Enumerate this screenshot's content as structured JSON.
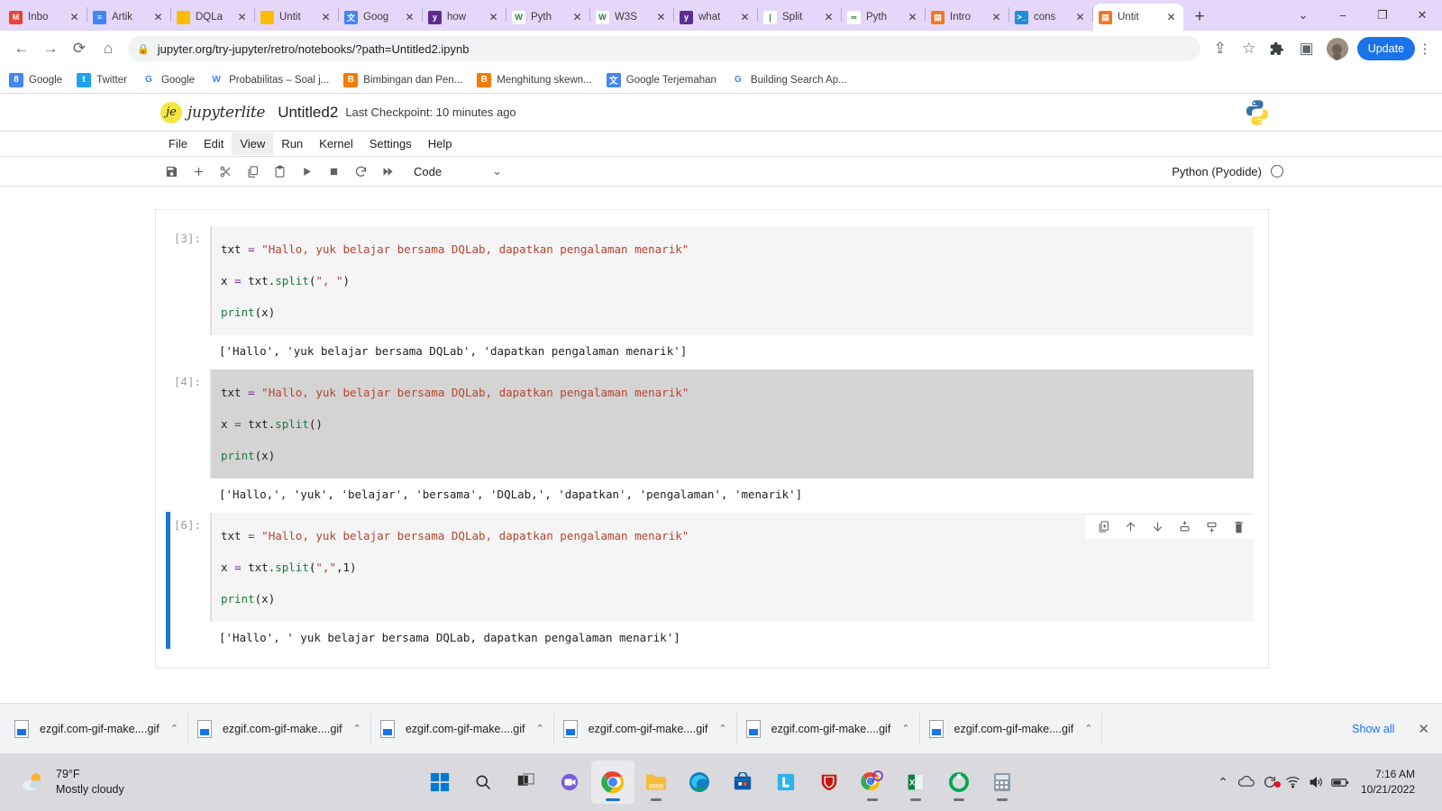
{
  "browser": {
    "tabs": [
      {
        "title": "Inbo",
        "icon": "gmail-icon",
        "color": "#ea4335",
        "glyph": "M",
        "active": false
      },
      {
        "title": "Artik",
        "icon": "docs-icon",
        "color": "#4285f4",
        "glyph": "≡",
        "active": false
      },
      {
        "title": "DQLa",
        "icon": "folder-icon",
        "color": "#fbbc04",
        "glyph": "",
        "active": false
      },
      {
        "title": "Untit",
        "icon": "folder-icon",
        "color": "#fbbc04",
        "glyph": "",
        "active": false
      },
      {
        "title": "Goog",
        "icon": "translate-icon",
        "color": "#4285f4",
        "glyph": "文",
        "active": false
      },
      {
        "title": "how",
        "icon": "w3schools-icon",
        "color": "#5c2d91",
        "glyph": "y",
        "active": false
      },
      {
        "title": "Pyth",
        "icon": "w3schools-green-icon",
        "color": "#ffffff",
        "glyph": "W",
        "active": false
      },
      {
        "title": "W3S",
        "icon": "w3schools-green-icon",
        "color": "#ffffff",
        "glyph": "W",
        "active": false
      },
      {
        "title": "what",
        "icon": "w3schools-icon",
        "color": "#5c2d91",
        "glyph": "y",
        "active": false
      },
      {
        "title": "Split",
        "icon": "split-icon",
        "color": "#ffffff",
        "glyph": "|",
        "active": false
      },
      {
        "title": "Pyth",
        "icon": "python-docs-icon",
        "color": "#ffffff",
        "glyph": "∞",
        "active": false
      },
      {
        "title": "Intro",
        "icon": "jupyter-icon",
        "color": "#f37726",
        "glyph": "▤",
        "active": false
      },
      {
        "title": "cons",
        "icon": "terminal-icon",
        "color": "#1e8fd5",
        "glyph": ">_",
        "active": false
      },
      {
        "title": "Untit",
        "icon": "jupyter-icon",
        "color": "#f37726",
        "glyph": "▤",
        "active": true
      }
    ],
    "new_tab_label": "+",
    "window_controls": {
      "list": "⌄",
      "minimize": "−",
      "maximize": "❐",
      "close": "✕"
    },
    "nav": {
      "back": "←",
      "forward": "→",
      "reload": "⟳",
      "home": "⌂"
    },
    "address": {
      "url": "jupyter.org/try-jupyter/retro/notebooks/?path=Untitled2.ipynb",
      "lock_icon": "lock-icon",
      "placeholder": "Search Google or type a URL"
    },
    "omnibox_actions": {
      "share": "⇪",
      "bookmark": "☆",
      "extensions": "🧩",
      "sidepanel": "▣"
    },
    "update_label": "Update",
    "menu_label": "⋮",
    "bookmarks": [
      {
        "label": "Google",
        "icon": "google-blue-icon",
        "color": "#4285f4",
        "glyph": "8"
      },
      {
        "label": "Twitter",
        "icon": "twitter-icon",
        "color": "#1da1f2",
        "glyph": "t"
      },
      {
        "label": "Google",
        "icon": "google-icon",
        "color": "#ffffff",
        "glyph": "G"
      },
      {
        "label": "Probabilitas – Soal j...",
        "icon": "wordpress-icon",
        "color": "#ffffff",
        "glyph": "W"
      },
      {
        "label": "Bimbingan dan Pen...",
        "icon": "blogger-icon",
        "color": "#f57c00",
        "glyph": "B"
      },
      {
        "label": "Menghitung skewn...",
        "icon": "blogger-icon",
        "color": "#f57c00",
        "glyph": "B"
      },
      {
        "label": "Google Terjemahan",
        "icon": "translate-icon",
        "color": "#4285f4",
        "glyph": "文"
      },
      {
        "label": "Building Search Ap...",
        "icon": "google-icon",
        "color": "#ffffff",
        "glyph": "G"
      }
    ]
  },
  "jupyter": {
    "brand": "jupyterlite",
    "brand_glyph": "je",
    "notebook_title": "Untitled2",
    "checkpoint": "Last Checkpoint: 10 minutes ago",
    "python_logo_icon": "python-logo-icon",
    "menus": [
      {
        "label": "File",
        "active": false
      },
      {
        "label": "Edit",
        "active": false
      },
      {
        "label": "View",
        "active": true
      },
      {
        "label": "Run",
        "active": false
      },
      {
        "label": "Kernel",
        "active": false
      },
      {
        "label": "Settings",
        "active": false
      },
      {
        "label": "Help",
        "active": false
      }
    ],
    "toolbar": [
      {
        "name": "save-icon",
        "glyph": "save"
      },
      {
        "name": "add-cell-icon",
        "glyph": "+"
      },
      {
        "name": "cut-icon",
        "glyph": "cut"
      },
      {
        "name": "copy-icon",
        "glyph": "copy"
      },
      {
        "name": "paste-icon",
        "glyph": "paste"
      },
      {
        "name": "run-icon",
        "glyph": "▶"
      },
      {
        "name": "stop-icon",
        "glyph": "■"
      },
      {
        "name": "restart-icon",
        "glyph": "⟳"
      },
      {
        "name": "restart-run-all-icon",
        "glyph": "▶▶"
      }
    ],
    "cell_type": {
      "value": "Code",
      "caret": "⌄"
    },
    "kernel": {
      "name": "Python (Pyodide)",
      "status_icon": "kernel-idle-circle"
    },
    "cell_tools": [
      {
        "name": "duplicate-cell-icon"
      },
      {
        "name": "move-cell-up-icon"
      },
      {
        "name": "move-cell-down-icon"
      },
      {
        "name": "insert-cell-above-icon"
      },
      {
        "name": "insert-cell-below-icon"
      },
      {
        "name": "delete-cell-icon"
      }
    ],
    "cells": [
      {
        "prompt": "[3]:",
        "active": false,
        "selected_code": false,
        "lines": [
          [
            {
              "t": "txt ",
              "c": "plain"
            },
            {
              "t": "=",
              "c": "op"
            },
            {
              "t": " ",
              "c": "plain"
            },
            {
              "t": "\"Hallo, yuk belajar bersama DQLab, dapatkan pengalaman menarik\"",
              "c": "str"
            }
          ],
          [
            {
              "t": "x ",
              "c": "plain"
            },
            {
              "t": "=",
              "c": "op"
            },
            {
              "t": " txt.",
              "c": "plain"
            },
            {
              "t": "split",
              "c": "fn"
            },
            {
              "t": "(",
              "c": "plain"
            },
            {
              "t": "\", \"",
              "c": "str"
            },
            {
              "t": ")",
              "c": "plain"
            }
          ],
          [
            {
              "t": "print",
              "c": "fn"
            },
            {
              "t": "(x)",
              "c": "plain"
            }
          ]
        ],
        "output": "['Hallo', 'yuk belajar bersama DQLab', 'dapatkan pengalaman menarik']"
      },
      {
        "prompt": "[4]:",
        "active": false,
        "selected_code": true,
        "lines": [
          [
            {
              "t": "txt ",
              "c": "plain"
            },
            {
              "t": "=",
              "c": "op"
            },
            {
              "t": " ",
              "c": "plain"
            },
            {
              "t": "\"Hallo, yuk belajar bersama DQLab, dapatkan pengalaman menarik\"",
              "c": "str"
            }
          ],
          [
            {
              "t": "x ",
              "c": "plain"
            },
            {
              "t": "=",
              "c": "op"
            },
            {
              "t": " txt.",
              "c": "plain"
            },
            {
              "t": "split",
              "c": "fn"
            },
            {
              "t": "()",
              "c": "plain"
            }
          ],
          [
            {
              "t": "print",
              "c": "fn"
            },
            {
              "t": "(x)",
              "c": "plain"
            }
          ]
        ],
        "output": "['Hallo,', 'yuk', 'belajar', 'bersama', 'DQLab,', 'dapatkan', 'pengalaman', 'menarik']"
      },
      {
        "prompt": "[6]:",
        "active": true,
        "selected_code": false,
        "lines": [
          [
            {
              "t": "txt ",
              "c": "plain"
            },
            {
              "t": "=",
              "c": "op"
            },
            {
              "t": " ",
              "c": "plain"
            },
            {
              "t": "\"Hallo, yuk belajar bersama DQLab, dapatkan pengalaman menarik\"",
              "c": "str"
            }
          ],
          [
            {
              "t": "x ",
              "c": "plain"
            },
            {
              "t": "=",
              "c": "op"
            },
            {
              "t": " txt.",
              "c": "plain"
            },
            {
              "t": "split",
              "c": "fn"
            },
            {
              "t": "(",
              "c": "plain"
            },
            {
              "t": "\",\"",
              "c": "str"
            },
            {
              "t": ",1)",
              "c": "plain"
            }
          ],
          [
            {
              "t": "print",
              "c": "fn"
            },
            {
              "t": "(x)",
              "c": "plain"
            }
          ]
        ],
        "output": "['Hallo', ' yuk belajar bersama DQLab, dapatkan pengalaman menarik']"
      }
    ]
  },
  "download_shelf": {
    "items": [
      {
        "label": "ezgif.com-gif-make....gif",
        "caret": "⌃"
      },
      {
        "label": "ezgif.com-gif-make....gif",
        "caret": "⌃"
      },
      {
        "label": "ezgif.com-gif-make....gif",
        "caret": "⌃"
      },
      {
        "label": "ezgif.com-gif-make....gif",
        "caret": "⌃"
      },
      {
        "label": "ezgif.com-gif-make....gif",
        "caret": "⌃"
      },
      {
        "label": "ezgif.com-gif-make....gif",
        "caret": "⌃"
      }
    ],
    "show_all_label": "Show all",
    "close_label": "✕"
  },
  "taskbar": {
    "weather": {
      "temperature": "79°F",
      "condition": "Mostly cloudy",
      "icon": "sun-cloud-icon"
    },
    "apps": [
      {
        "name": "start-icon",
        "active": false,
        "running": false
      },
      {
        "name": "search-icon",
        "active": false,
        "running": false
      },
      {
        "name": "task-view-icon",
        "active": false,
        "running": false
      },
      {
        "name": "teams-chat-icon",
        "active": false,
        "running": false
      },
      {
        "name": "chrome-icon",
        "active": true,
        "running": true
      },
      {
        "name": "file-explorer-icon",
        "active": false,
        "running": true
      },
      {
        "name": "edge-icon",
        "active": false,
        "running": false
      },
      {
        "name": "microsoft-store-icon",
        "active": false,
        "running": false
      },
      {
        "name": "line-icon",
        "active": false,
        "running": false
      },
      {
        "name": "mcafee-icon",
        "active": false,
        "running": false
      },
      {
        "name": "chrome-search-icon",
        "active": false,
        "running": true
      },
      {
        "name": "excel-icon",
        "active": false,
        "running": true
      },
      {
        "name": "spss-icon",
        "active": false,
        "running": true
      },
      {
        "name": "calculator-icon",
        "active": false,
        "running": true
      }
    ],
    "tray": [
      {
        "name": "show-hidden-icons-chevron",
        "glyph": "⌃"
      },
      {
        "name": "onedrive-icon",
        "glyph": "☁"
      },
      {
        "name": "update-available-icon",
        "glyph": "⟳"
      },
      {
        "name": "wifi-icon",
        "glyph": "wifi"
      },
      {
        "name": "volume-icon",
        "glyph": "🔊"
      },
      {
        "name": "battery-icon",
        "glyph": "battery"
      }
    ],
    "clock": {
      "time": "7:16 AM",
      "date": "10/21/2022"
    }
  }
}
